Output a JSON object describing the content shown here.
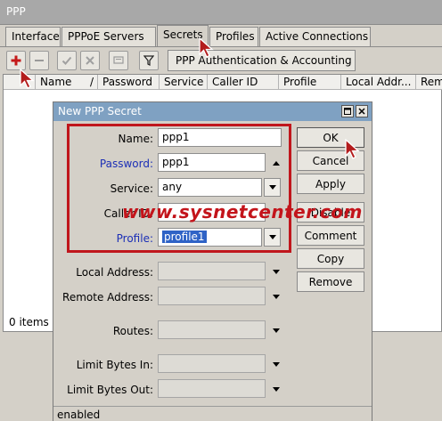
{
  "window": {
    "title": "PPP"
  },
  "tabs": [
    {
      "label": "Interface"
    },
    {
      "label": "PPPoE Servers"
    },
    {
      "label": "Secrets",
      "active": true
    },
    {
      "label": "Profiles"
    },
    {
      "label": "Active Connections"
    }
  ],
  "toolbar": {
    "add_icon": "plus-icon",
    "remove_icon": "minus-icon",
    "enable_icon": "check-icon",
    "disable_icon": "cross-icon",
    "comment_icon": "comment-icon",
    "filter_icon": "filter-icon",
    "auth_button_label": "PPP Authentication & Accounting"
  },
  "table": {
    "columns": [
      "Name",
      "Password",
      "Service",
      "Caller ID",
      "Profile",
      "Local Addr...",
      "Rem"
    ],
    "items_count": "0 items"
  },
  "dialog": {
    "title": "New PPP Secret",
    "fields": {
      "name": {
        "label": "Name:",
        "value": "ppp1"
      },
      "password": {
        "label": "Password:",
        "value": "ppp1"
      },
      "service": {
        "label": "Service:",
        "value": "any"
      },
      "caller_id": {
        "label": "Caller ID:",
        "value": ""
      },
      "profile": {
        "label": "Profile:",
        "value": "profile1"
      },
      "local_address": {
        "label": "Local Address:",
        "value": ""
      },
      "remote_address": {
        "label": "Remote Address:",
        "value": ""
      },
      "routes": {
        "label": "Routes:",
        "value": ""
      },
      "limit_bytes_in": {
        "label": "Limit Bytes In:",
        "value": ""
      },
      "limit_bytes_out": {
        "label": "Limit Bytes Out:",
        "value": ""
      }
    },
    "buttons": {
      "ok": "OK",
      "cancel": "Cancel",
      "apply": "Apply",
      "disable": "Disable",
      "comment": "Comment",
      "copy": "Copy",
      "remove": "Remove"
    },
    "status": "enabled"
  },
  "watermark": "www.sysnetcenter.com",
  "colors": {
    "highlight_box": "#c0161c",
    "dialog_title": "#7fa1c2",
    "selection": "#2f63c6",
    "blue_label": "#1c2fb6"
  }
}
